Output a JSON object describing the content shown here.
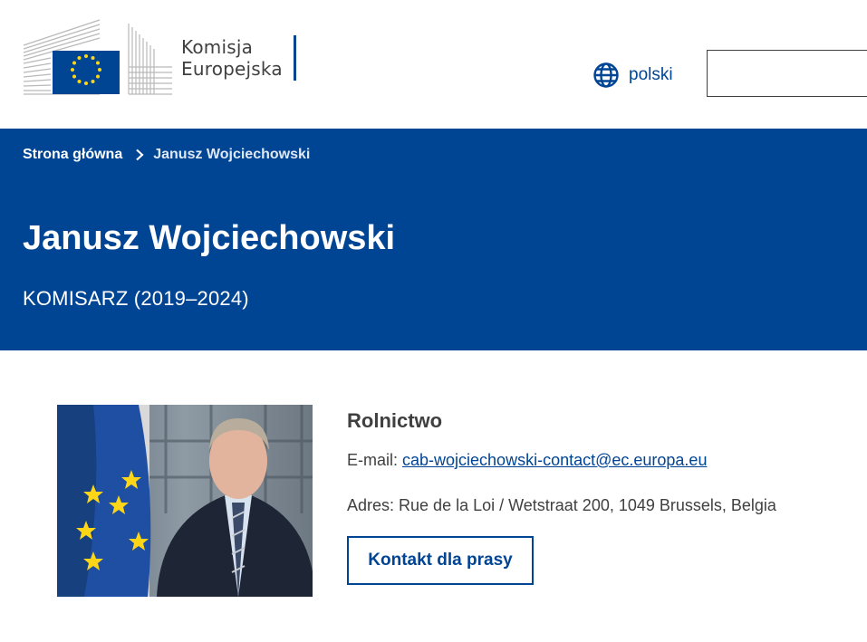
{
  "header": {
    "logo_line1": "Komisja",
    "logo_line2": "Europejska",
    "language_label": "polski",
    "icons": {
      "language": "globe-icon"
    }
  },
  "breadcrumb": {
    "home": "Strona główna",
    "current": "Janusz Wojciechowski",
    "separator_icon": "chevron-right-icon"
  },
  "page": {
    "title": "Janusz Wojciechowski",
    "subtitle": "KOMISARZ (2019–2024)"
  },
  "profile": {
    "portfolio": "Rolnictwo",
    "email_label": "E-mail: ",
    "email": "cab-wojciechowski-contact@ec.europa.eu",
    "address_label": "Adres: ",
    "address": "Rue de la Loi / Wetstraat 200, 1049 Brussels, Belgia",
    "press_button": "Kontakt dla prasy"
  },
  "colors": {
    "brand_blue": "#004494",
    "text": "#404040",
    "eu_yellow": "#ffd617"
  }
}
